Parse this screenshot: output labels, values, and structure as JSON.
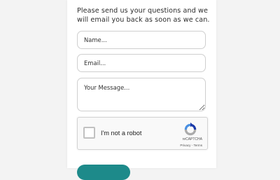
{
  "form": {
    "intro_text": "Please send us your questions and we will email you back as soon as we can.",
    "name_placeholder": "Name...",
    "email_placeholder": "Email...",
    "message_placeholder": "Your Message..."
  },
  "recaptcha": {
    "label": "I'm not a robot",
    "brand": "reCAPTCHA",
    "privacy_link": "Privacy",
    "separator": " - ",
    "terms_link": "Terms"
  },
  "icons": {
    "recaptcha_logo": "recaptcha-logo-icon"
  },
  "colors": {
    "submit_button": "#1d8a8a",
    "recaptcha_blue": "#1c3aa9",
    "recaptcha_lightblue": "#4a90e2",
    "recaptcha_gray": "#ababab"
  }
}
